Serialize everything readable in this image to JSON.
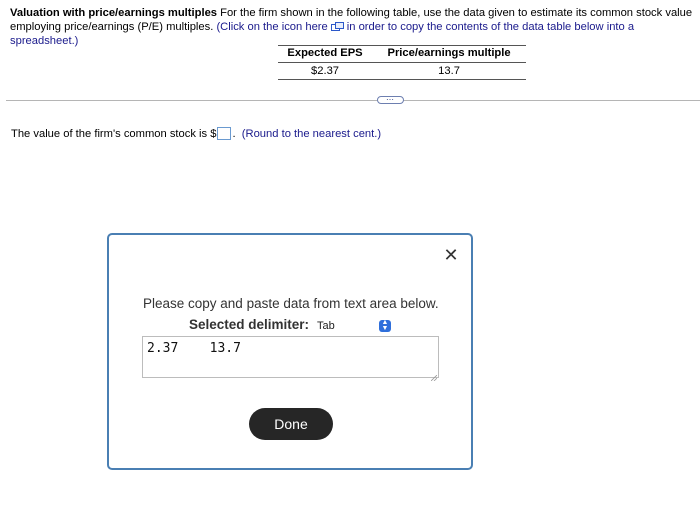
{
  "problem": {
    "title": "Valuation with price/earnings multiples",
    "intro": "For the firm shown in the following table, use the data given to estimate its common stock value employing price/earnings (P/E) multiples.",
    "copy_hint_before": "(Click on the icon here",
    "copy_hint_after": "in order to copy the contents of the data table below into a spreadsheet.)",
    "copy_icon": "copy-icon"
  },
  "table": {
    "headers": [
      "Expected EPS",
      "Price/earnings multiple"
    ],
    "row": [
      "$2.37",
      "13.7"
    ]
  },
  "more_button": {
    "label": "⋯"
  },
  "question": {
    "text_before": "The value of the firm's common stock is $",
    "answer_value": "",
    "text_after": ".",
    "hint": "(Round to the nearest cent.)"
  },
  "dialog": {
    "close_label": "✕",
    "instruction": "Please copy and paste data from text area below.",
    "delimiter_label": "Selected delimiter:",
    "delimiter_value": "Tab",
    "textarea_value": "2.37    13.7",
    "done_label": "Done"
  },
  "colors": {
    "dialog_border": "#4a7fb3",
    "done_button": "#262626",
    "link_text": "#1a1a8c",
    "select_arrow": "#2f6fdb"
  }
}
